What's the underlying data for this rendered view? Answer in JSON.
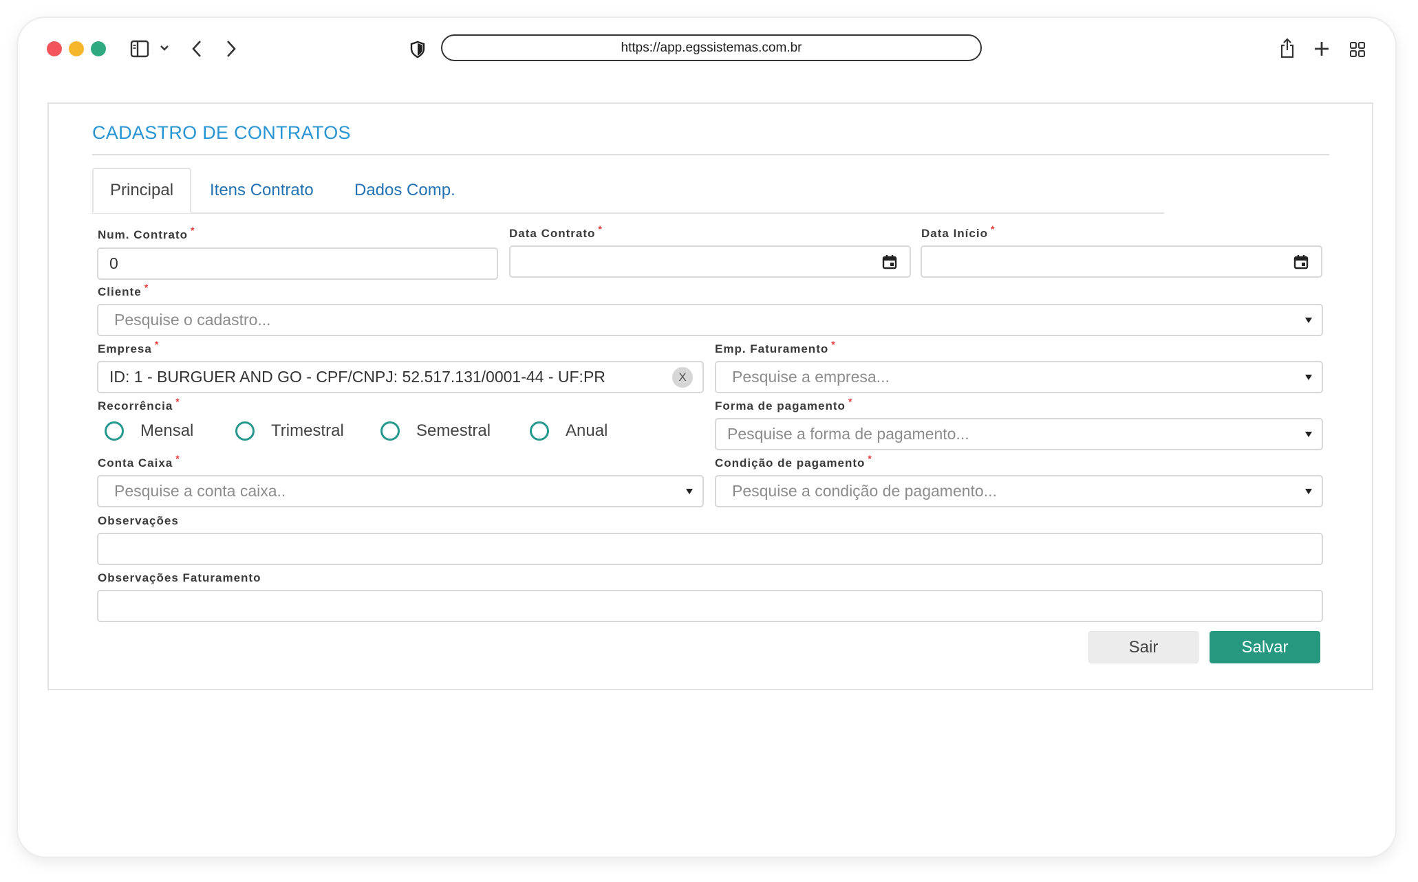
{
  "browser": {
    "url": "https://app.egssistemas.com.br",
    "icons": [
      "sidebar-icon",
      "chevron-down-icon",
      "back-icon",
      "forward-icon",
      "shield-icon",
      "share-icon",
      "new-tab-icon",
      "tab-overview-icon"
    ]
  },
  "page": {
    "title": "CADASTRO DE CONTRATOS",
    "tabs": [
      {
        "label": "Principal",
        "active": true
      },
      {
        "label": "Itens Contrato",
        "active": false
      },
      {
        "label": "Dados Comp.",
        "active": false
      }
    ]
  },
  "form": {
    "num_contrato": {
      "label": "Num. Contrato",
      "value": "0"
    },
    "data_contrato": {
      "label": "Data Contrato",
      "value": ""
    },
    "data_inicio": {
      "label": "Data Início",
      "value": ""
    },
    "cliente": {
      "label": "Cliente",
      "placeholder": "Pesquise o cadastro..."
    },
    "empresa": {
      "label": "Empresa",
      "value": "ID: 1 - BURGUER AND GO - CPF/CNPJ: 52.517.131/0001-44 - UF:PR",
      "clear": "X"
    },
    "emp_faturamento": {
      "label": "Emp. Faturamento",
      "placeholder": "Pesquise a empresa..."
    },
    "recorrencia": {
      "label": "Recorrência",
      "options": [
        "Mensal",
        "Trimestral",
        "Semestral",
        "Anual"
      ]
    },
    "forma_pagamento": {
      "label": "Forma de pagamento",
      "placeholder": "Pesquise a forma de pagamento..."
    },
    "conta_caixa": {
      "label": "Conta Caixa",
      "placeholder": "Pesquise a conta caixa.."
    },
    "condicao_pagamento": {
      "label": "Condição de pagamento",
      "placeholder": "Pesquise a condição de pagamento..."
    },
    "observacoes": {
      "label": "Observações",
      "value": ""
    },
    "observacoes_faturamento": {
      "label": "Observações Faturamento",
      "value": ""
    },
    "required_mark": "*"
  },
  "actions": {
    "sair": "Sair",
    "salvar": "Salvar"
  },
  "colors": {
    "accent": "#2795d3",
    "primary_button": "#25987f",
    "radio": "#26998e",
    "required": "#e13c3c"
  }
}
